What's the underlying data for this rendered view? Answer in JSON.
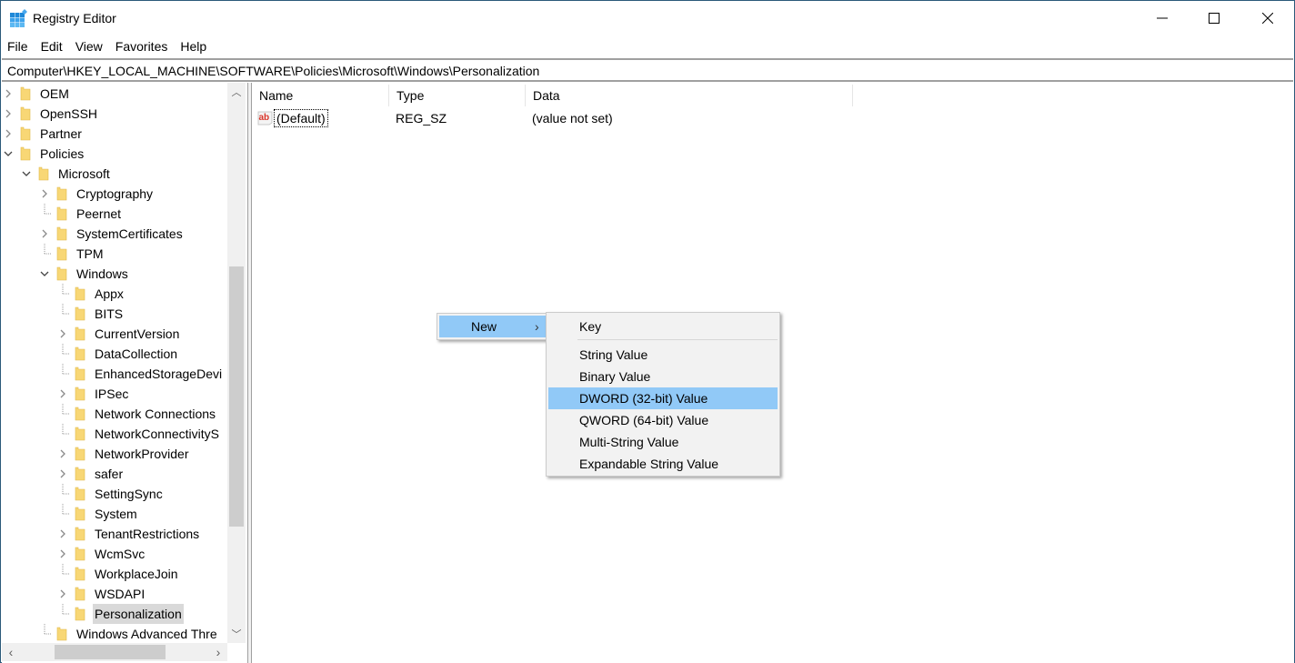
{
  "window": {
    "title": "Registry Editor",
    "controls": {
      "minimize": "—",
      "maximize": "☐",
      "close": "✕"
    }
  },
  "menubar": [
    "File",
    "Edit",
    "View",
    "Favorites",
    "Help"
  ],
  "address": "Computer\\HKEY_LOCAL_MACHINE\\SOFTWARE\\Policies\\Microsoft\\Windows\\Personalization",
  "tree": [
    {
      "label": "OEM",
      "level": 0,
      "expander": "collapsed"
    },
    {
      "label": "OpenSSH",
      "level": 0,
      "expander": "collapsed"
    },
    {
      "label": "Partner",
      "level": 0,
      "expander": "collapsed"
    },
    {
      "label": "Policies",
      "level": 0,
      "expander": "expanded"
    },
    {
      "label": "Microsoft",
      "level": 1,
      "expander": "expanded"
    },
    {
      "label": "Cryptography",
      "level": 2,
      "expander": "collapsed"
    },
    {
      "label": "Peernet",
      "level": 2,
      "expander": "none"
    },
    {
      "label": "SystemCertificates",
      "level": 2,
      "expander": "collapsed"
    },
    {
      "label": "TPM",
      "level": 2,
      "expander": "none"
    },
    {
      "label": "Windows",
      "level": 2,
      "expander": "expanded"
    },
    {
      "label": "Appx",
      "level": 3,
      "expander": "none"
    },
    {
      "label": "BITS",
      "level": 3,
      "expander": "none"
    },
    {
      "label": "CurrentVersion",
      "level": 3,
      "expander": "collapsed"
    },
    {
      "label": "DataCollection",
      "level": 3,
      "expander": "none"
    },
    {
      "label": "EnhancedStorageDevi",
      "level": 3,
      "expander": "none"
    },
    {
      "label": "IPSec",
      "level": 3,
      "expander": "collapsed"
    },
    {
      "label": "Network Connections",
      "level": 3,
      "expander": "none"
    },
    {
      "label": "NetworkConnectivityS",
      "level": 3,
      "expander": "none"
    },
    {
      "label": "NetworkProvider",
      "level": 3,
      "expander": "collapsed"
    },
    {
      "label": "safer",
      "level": 3,
      "expander": "collapsed"
    },
    {
      "label": "SettingSync",
      "level": 3,
      "expander": "none"
    },
    {
      "label": "System",
      "level": 3,
      "expander": "none"
    },
    {
      "label": "TenantRestrictions",
      "level": 3,
      "expander": "collapsed"
    },
    {
      "label": "WcmSvc",
      "level": 3,
      "expander": "collapsed"
    },
    {
      "label": "WorkplaceJoin",
      "level": 3,
      "expander": "none"
    },
    {
      "label": "WSDAPI",
      "level": 3,
      "expander": "collapsed"
    },
    {
      "label": "Personalization",
      "level": 3,
      "expander": "none",
      "selected": true
    },
    {
      "label": "Windows Advanced Thre",
      "level": 2,
      "expander": "none"
    }
  ],
  "list": {
    "columns": [
      "Name",
      "Type",
      "Data"
    ],
    "rows": [
      {
        "name": "(Default)",
        "type": "REG_SZ",
        "data": "(value not set)",
        "icon": "string-value-icon"
      }
    ]
  },
  "context_menu": {
    "item": "New",
    "arrow": "›",
    "submenu": [
      "Key",
      "String Value",
      "Binary Value",
      "DWORD (32-bit) Value",
      "QWORD (64-bit) Value",
      "Multi-String Value",
      "Expandable String Value"
    ],
    "highlighted": "DWORD (32-bit) Value"
  },
  "colors": {
    "highlight": "#91c9f7",
    "folder": "#f8d775",
    "selected_tree": "#d9d9d9"
  }
}
